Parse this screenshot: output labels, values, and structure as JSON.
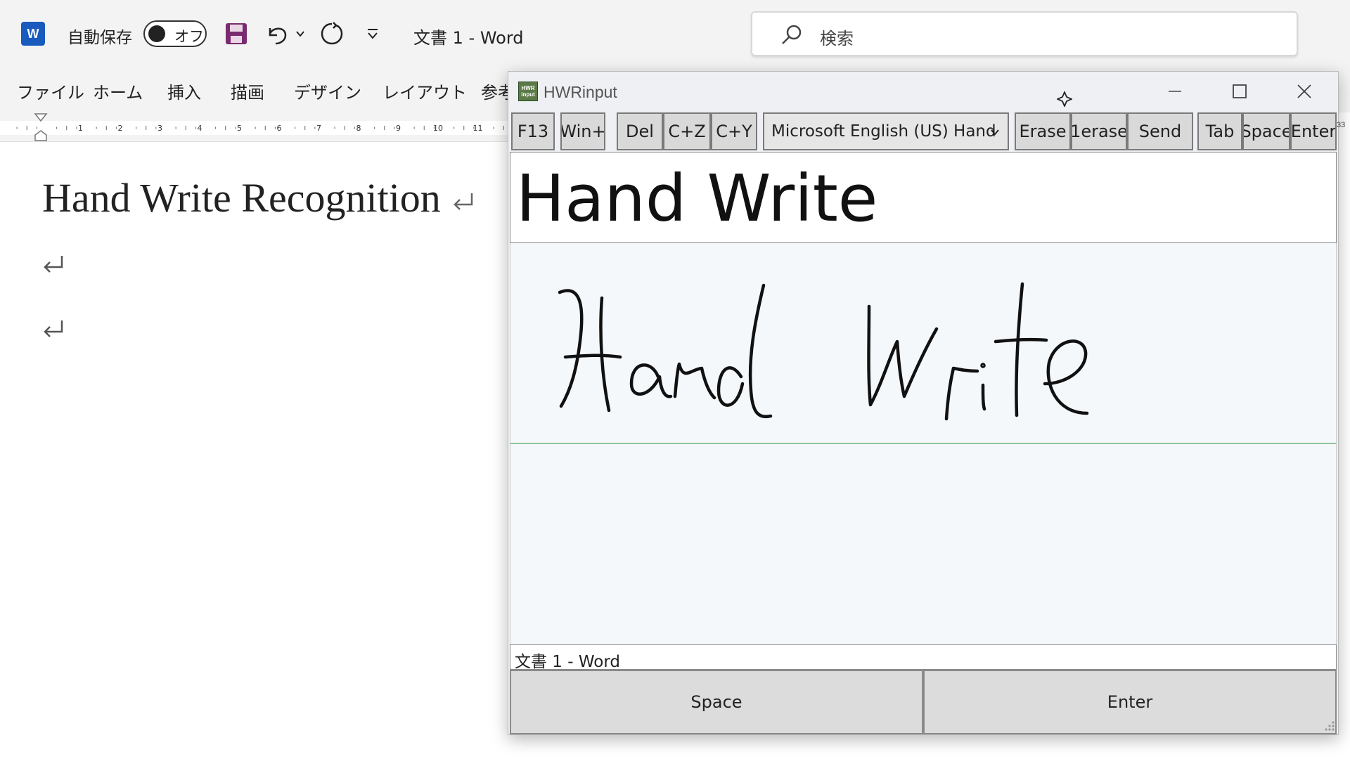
{
  "word": {
    "app_logo": "W",
    "autosave_label": "自動保存",
    "autosave_state": "オフ",
    "title": "文書 1  -  Word",
    "search_placeholder": "検索",
    "menu": [
      "ファイル",
      "ホーム",
      "挿入",
      "描画",
      "デザイン",
      "レイアウト",
      "参考"
    ],
    "ruler_numbers": [
      "1",
      "2",
      "3",
      "4",
      "5",
      "6",
      "7",
      "8",
      "9",
      "10",
      "11"
    ],
    "document": {
      "heading": "Hand Write Recognition"
    },
    "icons": [
      "save-icon",
      "undo-icon",
      "redo-icon",
      "customize-qat-icon",
      "search-icon",
      "paragraph-mark-icon"
    ]
  },
  "hwr": {
    "logo_text": "HWR input",
    "title": "HWRinput",
    "toolbar": {
      "f13": "F13",
      "win": "Win+",
      "del": "Del",
      "undo": "C+Z",
      "redo": "C+Y",
      "recognizer": "Microsoft English (US) Hand",
      "erase": "Erase",
      "one_erase": "1erase",
      "send": "Send",
      "tab": "Tab",
      "space": "Space",
      "enter": "Enter"
    },
    "edge_number": "33",
    "result_text": "Hand Write",
    "ink_text": "Hand Write",
    "target_window": "文書 1 - Word",
    "bottom": {
      "space": "Space",
      "enter": "Enter"
    },
    "colors": {
      "guide_line": "#8fc79a",
      "ink": "#111111",
      "window_bg": "#eef0f3"
    }
  }
}
